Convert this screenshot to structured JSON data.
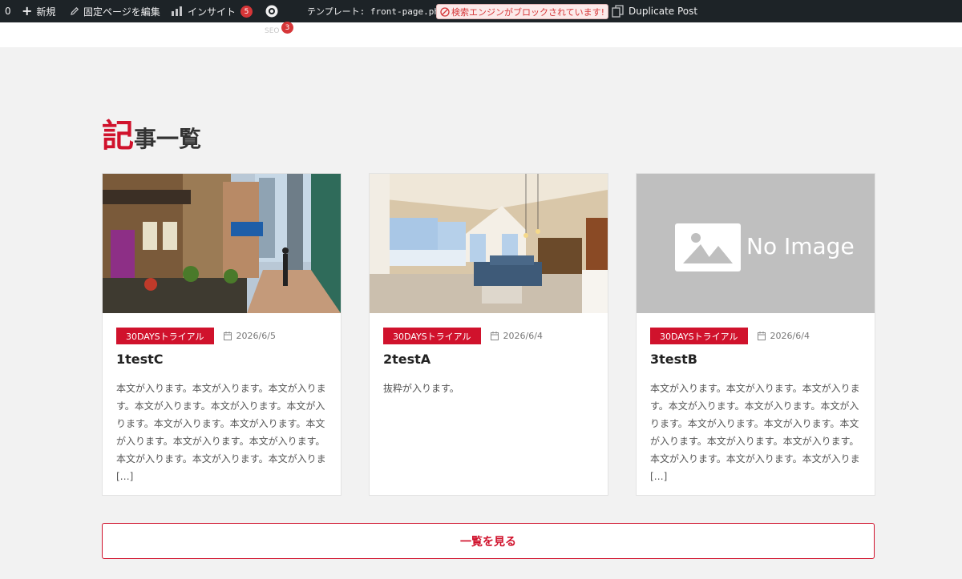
{
  "adminbar": {
    "counter_left": "0",
    "new_label": "新規",
    "edit_label": "固定ページを編集",
    "insight_label": "インサイト",
    "insight_count": "5",
    "seo_label": "SEO",
    "seo_count": "3",
    "template_label": "テンプレート: front-page.php",
    "search_warning": "検索エンジンがブロックされています!",
    "duplicate_label": "Duplicate Post"
  },
  "section": {
    "title_first": "記",
    "title_rest": "事一覧"
  },
  "cards": [
    {
      "category": "30DAYSトライアル",
      "date": "2026/6/5",
      "title": "1testC",
      "excerpt": "本文が入ります。本文が入ります。本文が入ります。本文が入ります。本文が入ります。本文が入ります。本文が入ります。本文が入ります。本文が入ります。本文が入ります。本文が入ります。本文が入ります。本文が入ります。本文が入りま […]",
      "image": "street-scene"
    },
    {
      "category": "30DAYSトライアル",
      "date": "2026/6/4",
      "title": "2testA",
      "excerpt": "抜粋が入ります。",
      "image": "living-room"
    },
    {
      "category": "30DAYSトライアル",
      "date": "2026/6/4",
      "title": "3testB",
      "excerpt": "本文が入ります。本文が入ります。本文が入ります。本文が入ります。本文が入ります。本文が入ります。本文が入ります。本文が入ります。本文が入ります。本文が入ります。本文が入ります。本文が入ります。本文が入ります。本文が入りま […]",
      "image": "no-image",
      "no_image_text": "No Image"
    }
  ],
  "more_button": "一覧を見る",
  "colors": {
    "accent": "#d0122c",
    "adminbar_bg": "#1d2327",
    "page_bg": "#f2f2f2"
  }
}
